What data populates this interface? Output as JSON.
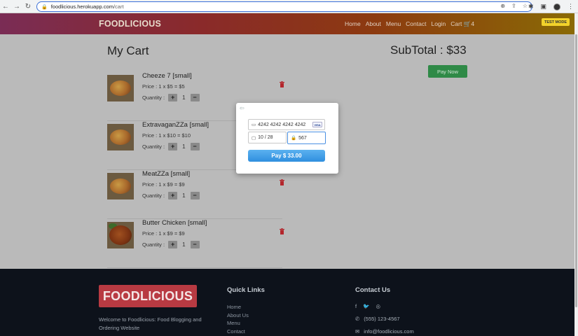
{
  "browser": {
    "url_host": "foodlicious.herokuapp.com",
    "url_path": "/cart"
  },
  "header": {
    "brand": "FOODLICIOUS",
    "nav": [
      "Home",
      "About",
      "Menu",
      "Contact",
      "Login",
      "Cart"
    ],
    "cart_count": "4",
    "test_mode": "TEST MODE"
  },
  "cart": {
    "title": "My Cart",
    "subtotal": "SubTotal : $33",
    "pay_now": "Pay Now",
    "quantity_label": "Quantity :",
    "items": [
      {
        "name": "Cheeze 7 [small]",
        "price": "Price : 1 x $5 = $5",
        "qty": "1"
      },
      {
        "name": "ExtravaganZZa [small]",
        "price": "Price : 1 x $10 = $10",
        "qty": "1"
      },
      {
        "name": "MeatZZa [small]",
        "price": "Price : 1 x $9 = $9",
        "qty": "1"
      },
      {
        "name": "Butter Chicken [small]",
        "price": "Price : 1 x $9 = $9",
        "qty": "1"
      }
    ]
  },
  "payment": {
    "card_number": "4242 4242 4242 4242",
    "card_brand": "VISA",
    "expiry": "10 / 28",
    "cvc": "567",
    "pay_button": "Pay $ 33.00"
  },
  "footer": {
    "logo": "FOODLICIOUS",
    "welcome": "Welcome to Foodlicious: Food Blogging and Ordering Website",
    "quick_links_title": "Quick Links",
    "quick_links": [
      "Home",
      "About Us",
      "Menu",
      "Contact"
    ],
    "contact_title": "Contact Us",
    "phone": "(555) 123-4567",
    "email": "info@foodlicious.com"
  },
  "colors": {
    "pay_now_bg": "#2f8a47",
    "pay_button_bg": "#2f8fdf",
    "test_mode_bg": "#f2d22a",
    "footer_bg": "#0d121b",
    "footer_logo_bg": "#b83a42"
  }
}
